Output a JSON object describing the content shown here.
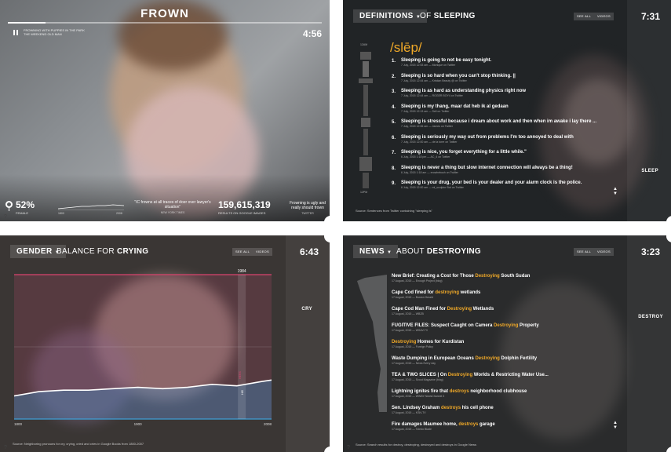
{
  "colors": {
    "accent": "#f0a928",
    "pink": "#d9436e",
    "blue": "#3f9fd6",
    "white": "#ffffff"
  },
  "panel1": {
    "title": "FROWN",
    "song_line1": "FROWNING WITH PUPPIES IN THE PARK",
    "song_line2": "THE WEEKEND OLD MAN",
    "time": "4:56",
    "female_pct": "52%",
    "female_label": "FEMALE",
    "years_label_left": "1800",
    "years_label_right": "2008",
    "quote": "\"IC frowns at all traces of doer over lawyer's situation\"",
    "quote_src": "NEW YORK TIMES",
    "count": "159,615,319",
    "count_label": "RESULTS ON GOOGLE IMAGES",
    "quote2": "Frowning is ugly and really should frown",
    "quote2_src": "TWITTER",
    "help": "?"
  },
  "panel2": {
    "category": "DEFINITIONS",
    "prefix": "OF",
    "word": "SLEEPING",
    "see_all": "SEE ALL",
    "videos": "VIDEOS",
    "time": "7:31",
    "side_word": "SLEEP",
    "phonetic": "/slēp/",
    "spine_top": "12AM",
    "spine_bottom": "12PM",
    "definitions": [
      {
        "num": "1.",
        "text": "Sleeping is going to not be easy tonight.",
        "meta": "7 July, 2015 12:53 am — Monique on Twitter"
      },
      {
        "num": "2.",
        "text": "Sleeping is so hard when you can't stop thinking. ||",
        "meta": "7 July, 2015 12:44 am — Kristian Beauty @ on Twitter"
      },
      {
        "num": "3.",
        "text": "Sleeping is as hard as understanding physics right now",
        "meta": "7 July, 2015 12:44 am — ROGER BOY4 on Twitter"
      },
      {
        "num": "4.",
        "text": "Sleeping is my thang, maar dat heb ik al gedaan",
        "meta": "7 July, 2015 12:13 am — Sell on Twitter"
      },
      {
        "num": "5.",
        "text": "Sleeping is stressful because i dream about work and then when im awake i lay there ...",
        "meta": "7 July, 2015 12:06 am — James on Twitter"
      },
      {
        "num": "6.",
        "text": "Sleeping is seriously my way out from problems I'm too annoyed to deal with",
        "meta": "7 July, 2015 12:00 am — de la torre on Twitter"
      },
      {
        "num": "7.",
        "text": "Sleeping is nice, you forget everything for a little while.\"",
        "meta": "6 July, 2015 1:18 pm — AC_4 on Twitter"
      },
      {
        "num": "8.",
        "text": "Sleeping is never a thing but slow internet connection will always be a thing!",
        "meta": "6 July, 2015 1:18 am — erowhebush on Twitter"
      },
      {
        "num": "9.",
        "text": "Sleeping is your drug, your bed is your dealer and your alarm clock is the police.",
        "meta": "6 July, 2015 12:00 am — ml_sculptor Bot on Twitter"
      }
    ],
    "source": "Source: Sentences from Twitter containing \"sleeping is\"",
    "help": "?"
  },
  "panel3": {
    "category": "GENDER",
    "prefix": "BALANCE FOR",
    "word": "CRYING",
    "see_all": "SEE ALL",
    "videos": "VIDEOS",
    "time": "6:43",
    "side_word": "CRY",
    "marker_year": "1984",
    "marker_label": "HERS",
    "marker_label2": "HIS",
    "x_ticks": [
      "1800",
      "1900",
      "2008"
    ],
    "source": "Source: Neighboring pronouns for cry, crying, cried and cries in Google Books from 1800-2007",
    "help": "?"
  },
  "chart_data": {
    "type": "area",
    "x": [
      1800,
      1820,
      1840,
      1860,
      1880,
      1900,
      1920,
      1940,
      1960,
      1980,
      2000,
      2008
    ],
    "values": [
      0.16,
      0.19,
      0.2,
      0.2,
      0.21,
      0.22,
      0.21,
      0.22,
      0.24,
      0.23,
      0.26,
      0.27
    ],
    "xlim": [
      1800,
      2008
    ],
    "ylim": [
      0,
      1
    ],
    "marker_year": 1984
  },
  "panel4": {
    "category": "NEWS",
    "prefix": "ABOUT",
    "word": "DESTROYING",
    "see_all": "SEE ALL",
    "videos": "VIDEOS",
    "time": "3:23",
    "side_word": "DESTROY",
    "items": [
      {
        "pre": "New Brief: Creating a Cost for Those ",
        "hl": "Destroying",
        "post": " South Sudan",
        "meta": "17 August, 2015 — Enough Project (blog)"
      },
      {
        "pre": "Cape Cod fined for ",
        "hl": "destroying",
        "post": " wetlands",
        "meta": "17 August, 2015 — Boston Herald"
      },
      {
        "pre": "Cape Cod Man Fined for ",
        "hl": "Destroying",
        "post": " Wetlands",
        "meta": "17 August, 2015 — WBZB"
      },
      {
        "pre": "FUGITIVE FILES: Suspect Caught on Camera ",
        "hl": "Destroying",
        "post": " Property",
        "meta": "17 August, 2015 — WSAV-TV"
      },
      {
        "pre": "",
        "hl": "Destroying",
        "post": " Homes for Kurdistan",
        "meta": "17 August, 2015 — Foreign Policy"
      },
      {
        "pre": "Waste Dumping in European Oceans ",
        "hl": "Destroying",
        "post": " Dolphin Fertility",
        "meta": "17 August, 2015 — News Every day"
      },
      {
        "pre": "TEA & TWO SLICES | On ",
        "hl": "Destroying",
        "post": " Worlds & Restricting Water Use...",
        "meta": "17 August, 2015 — Scout Magazine (blog)"
      },
      {
        "pre": "Lightning ignites fire that ",
        "hl": "destroys",
        "post": " neighborhood clubhouse",
        "meta": "17 August, 2015 — WWAY NewsChannel 3"
      },
      {
        "pre": "Sen. Lindsey Graham ",
        "hl": "destroys",
        "post": " his cell phone",
        "meta": "17 August, 2015 — KSN-TV"
      },
      {
        "pre": "Fire damages Maumee home, ",
        "hl": "destroys",
        "post": " garage",
        "meta": "17 August, 2015 — Toledo Blade"
      }
    ],
    "source": "Source: Search results for destroy, destroying, destroyed and destroys in Google News",
    "help": "?"
  }
}
